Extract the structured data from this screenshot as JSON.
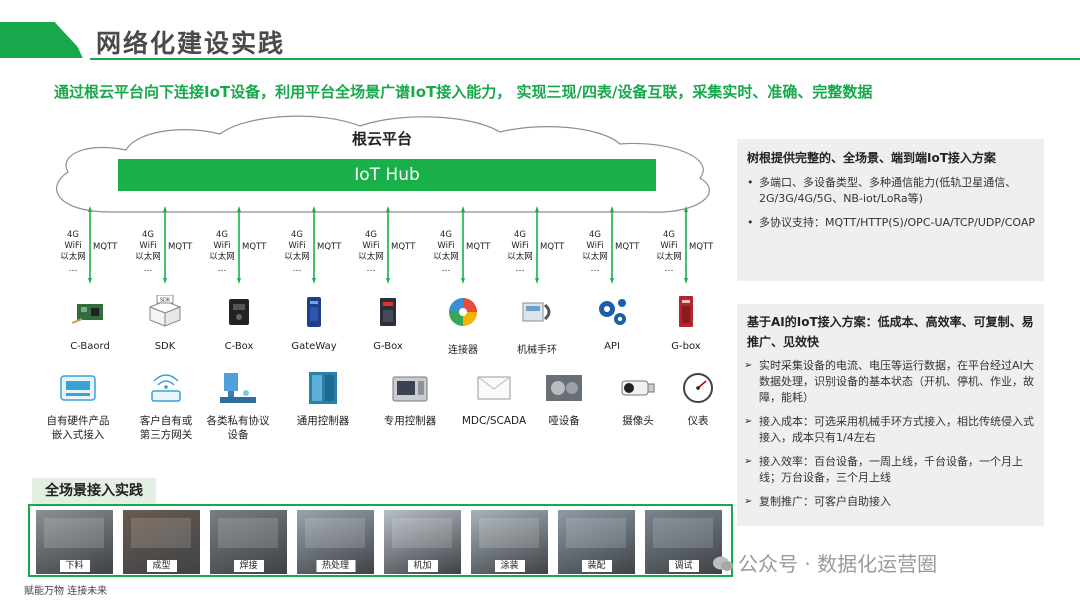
{
  "header": {
    "title": "网络化建设实践"
  },
  "subtitle": "通过根云平台向下连接IoT设备，利用平台全场景广谱IoT接入能力， 实现三现/四表/设备互联，采集实时、准确、完整数据",
  "cloud": {
    "label": "根云平台",
    "hub": "IoT Hub"
  },
  "connectors": [
    {
      "left": "4G\nWiFi\n以太网",
      "right": "MQTT",
      "dots": "…"
    },
    {
      "left": "4G\nWiFi\n以太网",
      "right": "MQTT",
      "dots": "…"
    },
    {
      "left": "4G\nWiFi\n以太网",
      "right": "MQTT",
      "dots": "…"
    },
    {
      "left": "4G\nWiFi\n以太网",
      "right": "MQTT",
      "dots": "…"
    },
    {
      "left": "4G\nWiFi\n以太网",
      "right": "MQTT",
      "dots": "…"
    },
    {
      "left": "4G\nWiFi\n以太网",
      "right": "MQTT",
      "dots": "…"
    },
    {
      "left": "4G\nWiFi\n以太网",
      "right": "MQTT",
      "dots": "…"
    },
    {
      "left": "4G\nWiFi\n以太网",
      "right": "MQTT",
      "dots": "…"
    },
    {
      "left": "4G\nWiFi\n以太网",
      "right": "MQTT",
      "dots": "…"
    }
  ],
  "devices_row1": [
    {
      "label": "C-Baord",
      "icon": "circuit-board-icon"
    },
    {
      "label": "SDK",
      "icon": "sdk-box-icon",
      "icon_text": "SDK"
    },
    {
      "label": "C-Box",
      "icon": "c-box-icon"
    },
    {
      "label": "GateWay",
      "icon": "gateway-icon"
    },
    {
      "label": "G-Box",
      "icon": "g-box-icon"
    },
    {
      "label": "连接器",
      "icon": "puzzle-connector-icon"
    },
    {
      "label": "机械手环",
      "icon": "mechanical-ring-icon"
    },
    {
      "label": "API",
      "icon": "gears-icon"
    },
    {
      "label": "G-box",
      "icon": "g-box-red-icon"
    }
  ],
  "devices_row2": [
    {
      "label": "自有硬件产品\n嵌入式接入",
      "icon": "embedded-hardware-icon"
    },
    {
      "label": "客户自有或\n第三方网关",
      "icon": "wireless-gateway-icon"
    },
    {
      "label": "各类私有协议\n设备",
      "icon": "cnc-machine-icon"
    },
    {
      "label": "通用控制器",
      "icon": "controller-cabinet-icon"
    },
    {
      "label": "专用控制器",
      "icon": "lathe-icon"
    },
    {
      "label": "MDC/SCADA",
      "icon": "mdc-scada-icon"
    },
    {
      "label": "哑设备",
      "icon": "dumb-device-icon"
    },
    {
      "label": "摄像头",
      "icon": "camera-icon"
    },
    {
      "label": "仪表",
      "icon": "gauge-icon"
    }
  ],
  "panel1": {
    "title": "树根提供完整的、全场景、端到端IoT接入方案",
    "items": [
      "多端口、多设备类型、多种通信能力(低轨卫星通信、2G/3G/4G/5G、NB-iot/LoRa等)",
      "多协议支持：MQTT/HTTP(S)/OPC-UA/TCP/UDP/COAP"
    ]
  },
  "panel2": {
    "title": "基于AI的IoT接入方案：低成本、高效率、可复制、易推广、见效快",
    "items": [
      "实时采集设备的电流、电压等运行数据，在平台经过AI大数据处理，识别设备的基本状态（开机、停机、作业，故障，能耗）",
      "接入成本：可选采用机械手环方式接入，相比传统侵入式接入，成本只有1/4左右",
      "接入效率：百台设备，一周上线，千台设备，一个月上线；万台设备，三个月上线",
      "复制推广：可客户自助接入"
    ]
  },
  "bottom": {
    "title": "全场景接入实践",
    "photos": [
      "下料",
      "成型",
      "焊接",
      "热处理",
      "机加",
      "涂装",
      "装配",
      "调试"
    ]
  },
  "footer": "赋能万物 连接未来",
  "watermark": "公众号 · 数据化运营圈",
  "colors": {
    "brand_green": "#17a84b",
    "hub_green": "#19b04a"
  }
}
